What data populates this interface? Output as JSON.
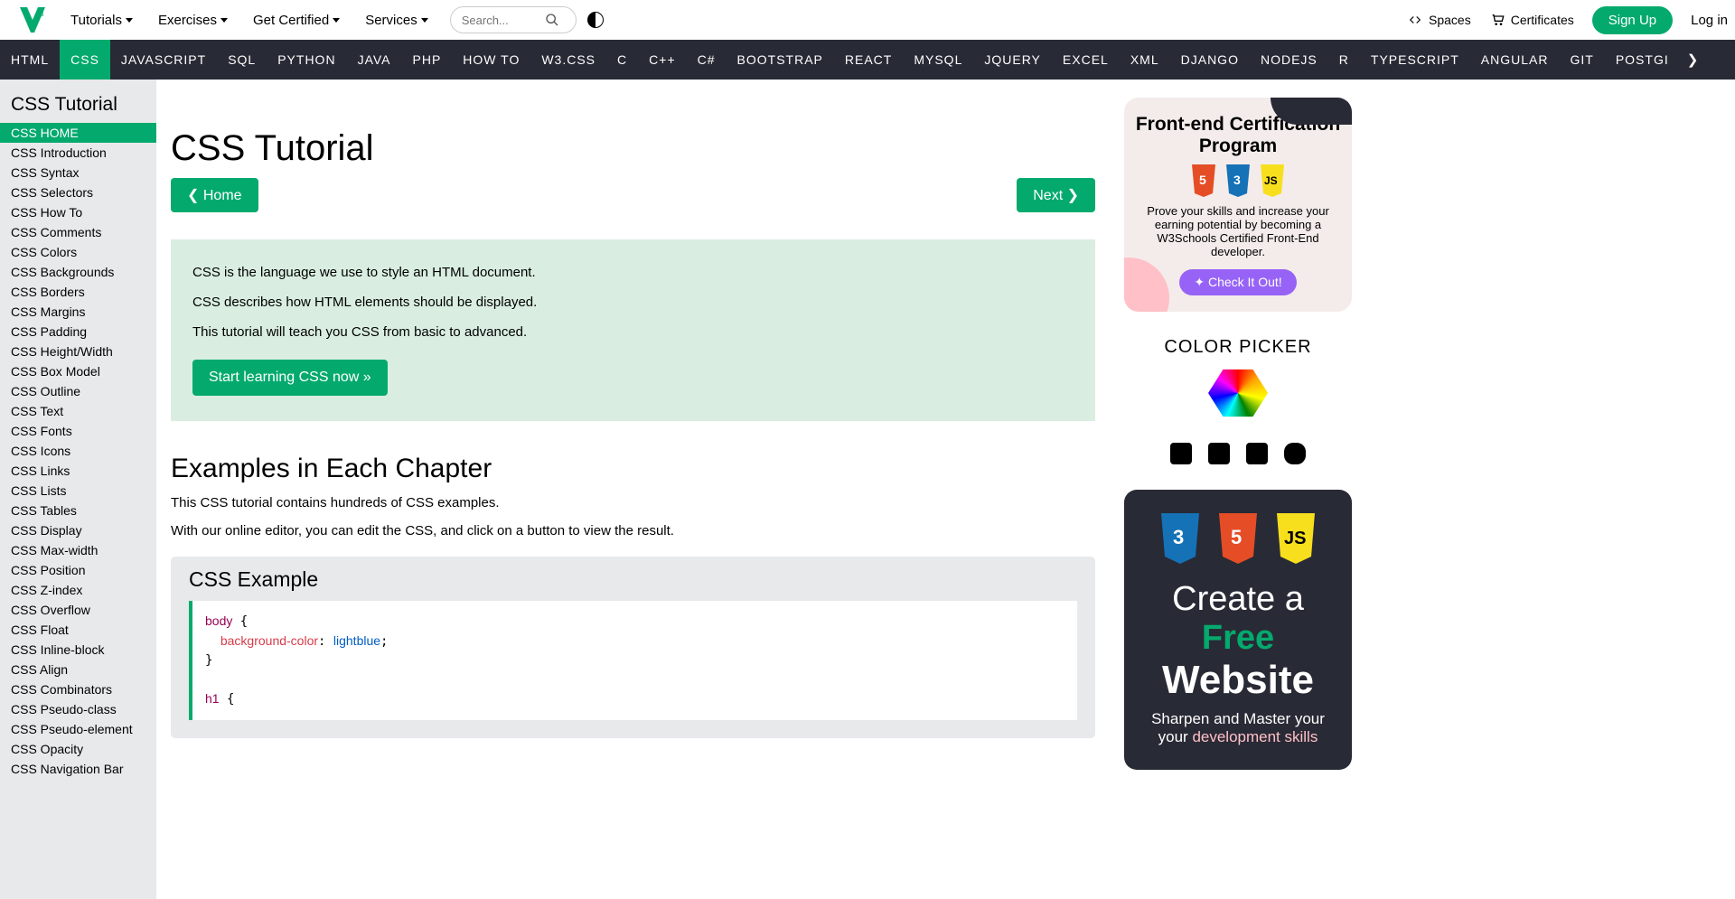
{
  "top": {
    "tutorials": "Tutorials",
    "exercises": "Exercises",
    "getcert": "Get Certified",
    "services": "Services",
    "search_ph": "Search...",
    "spaces": "Spaces",
    "certs": "Certificates",
    "signup": "Sign Up",
    "login": "Log in"
  },
  "nav": [
    "HTML",
    "CSS",
    "JAVASCRIPT",
    "SQL",
    "PYTHON",
    "JAVA",
    "PHP",
    "HOW TO",
    "W3.CSS",
    "C",
    "C++",
    "C#",
    "BOOTSTRAP",
    "REACT",
    "MYSQL",
    "JQUERY",
    "EXCEL",
    "XML",
    "DJANGO",
    "NODEJS",
    "R",
    "TYPESCRIPT",
    "ANGULAR",
    "GIT",
    "POSTGI"
  ],
  "nav_active": 1,
  "sidebar": {
    "title": "CSS Tutorial",
    "items": [
      "CSS HOME",
      "CSS Introduction",
      "CSS Syntax",
      "CSS Selectors",
      "CSS How To",
      "CSS Comments",
      "CSS Colors",
      "CSS Backgrounds",
      "CSS Borders",
      "CSS Margins",
      "CSS Padding",
      "CSS Height/Width",
      "CSS Box Model",
      "CSS Outline",
      "CSS Text",
      "CSS Fonts",
      "CSS Icons",
      "CSS Links",
      "CSS Lists",
      "CSS Tables",
      "CSS Display",
      "CSS Max-width",
      "CSS Position",
      "CSS Z-index",
      "CSS Overflow",
      "CSS Float",
      "CSS Inline-block",
      "CSS Align",
      "CSS Combinators",
      "CSS Pseudo-class",
      "CSS Pseudo-element",
      "CSS Opacity",
      "CSS Navigation Bar"
    ],
    "selected": 0
  },
  "content": {
    "h1": "CSS Tutorial",
    "home": "Home",
    "next": "Next",
    "intro1": "CSS is the language we use to style an HTML document.",
    "intro2": "CSS describes how HTML elements should be displayed.",
    "intro3": "This tutorial will teach you CSS from basic to advanced.",
    "start": "Start learning CSS now »",
    "h2": "Examples in Each Chapter",
    "p1": "This CSS tutorial contains hundreds of CSS examples.",
    "p2": "With our online editor, you can edit the CSS, and click on a button to view the result.",
    "example_title": "CSS Example",
    "code": {
      "sel1": "body",
      "prop1": "background-color",
      "val1": "lightblue",
      "sel2": "h1"
    }
  },
  "ad1": {
    "title": "Front-end Certification Program",
    "desc": "Prove your skills and increase your earning potential by becoming a W3Schools Certified Front-End developer.",
    "cta": "Check It Out!"
  },
  "cp": {
    "title": "COLOR PICKER"
  },
  "ad2": {
    "line1a": "Create a ",
    "line1b": "Free",
    "line2": "Website",
    "sub1": "Sharpen and Master your",
    "sub2a": "development skills"
  }
}
